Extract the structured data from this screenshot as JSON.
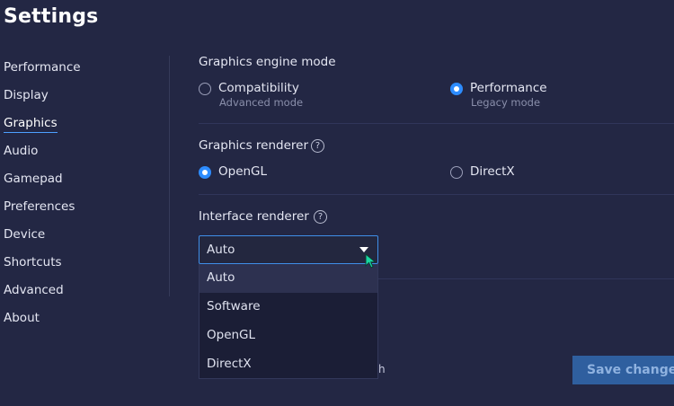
{
  "header": {
    "title": "Settings"
  },
  "sidebar": {
    "items": [
      {
        "label": "Performance"
      },
      {
        "label": "Display"
      },
      {
        "label": "Graphics",
        "active": true
      },
      {
        "label": "Audio"
      },
      {
        "label": "Gamepad"
      },
      {
        "label": "Preferences"
      },
      {
        "label": "Device"
      },
      {
        "label": "Shortcuts"
      },
      {
        "label": "Advanced"
      },
      {
        "label": "About"
      }
    ]
  },
  "graphics_engine": {
    "title": "Graphics engine mode",
    "options": [
      {
        "label": "Compatibility",
        "sub": "Advanced mode",
        "selected": false
      },
      {
        "label": "Performance",
        "sub": "Legacy mode",
        "selected": true
      }
    ]
  },
  "graphics_renderer": {
    "title": "Graphics renderer",
    "help": "?",
    "options": [
      {
        "label": "OpenGL",
        "selected": true
      },
      {
        "label": "DirectX",
        "selected": false
      }
    ]
  },
  "interface_renderer": {
    "title": "Interface renderer",
    "help": "?",
    "value": "Auto",
    "options": [
      "Auto",
      "Software",
      "OpenGL",
      "DirectX"
    ],
    "hovered": "Auto"
  },
  "partial_label": "h",
  "footer": {
    "save_label": "Save changes"
  },
  "colors": {
    "background": "#232744",
    "accent": "#2d8cff",
    "dropdown_bg": "#1b1e36",
    "save_button": "#2f5f9f"
  }
}
